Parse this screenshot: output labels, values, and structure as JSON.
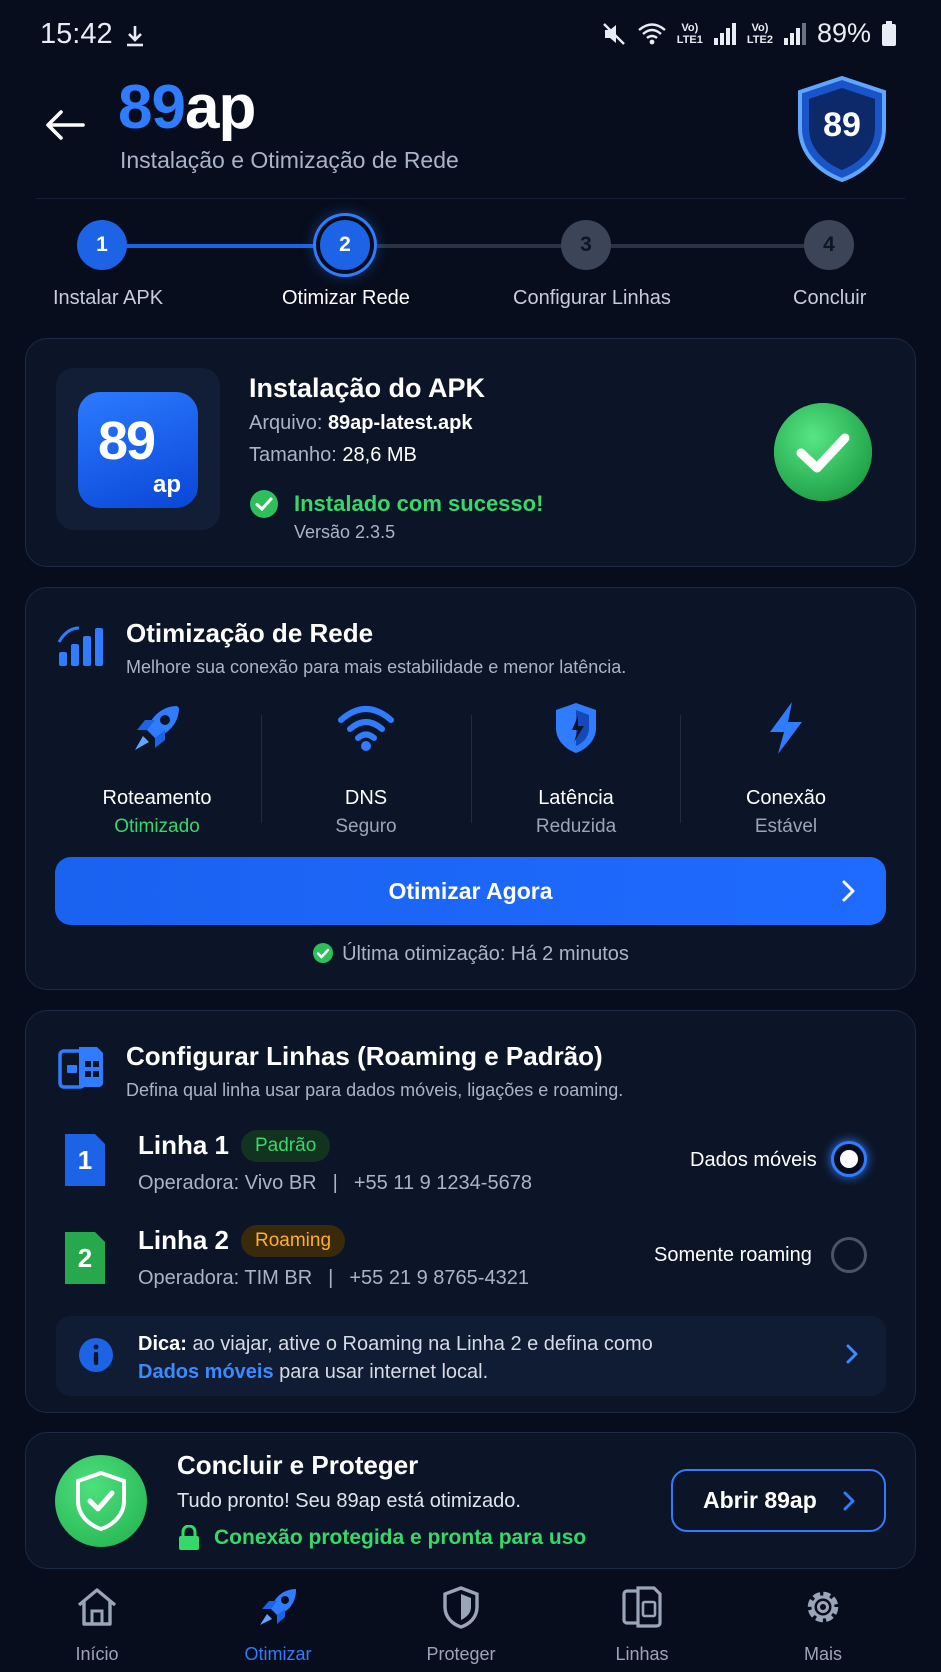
{
  "status_bar": {
    "time": "15:42",
    "lte1": "Vo)\nLTE1",
    "lte2": "Vo)\nLTE2",
    "battery": "89%"
  },
  "header": {
    "brand_part1": "89",
    "brand_part2": "ap",
    "subtitle": "Instalação e Otimização de Rede",
    "badge_number": "89"
  },
  "stepper": {
    "steps": [
      {
        "number": "1",
        "label": "Instalar APK",
        "state": "done"
      },
      {
        "number": "2",
        "label": "Otimizar Rede",
        "state": "active"
      },
      {
        "number": "3",
        "label": "Configurar Linhas",
        "state": "pending"
      },
      {
        "number": "4",
        "label": "Concluir",
        "state": "pending"
      }
    ]
  },
  "apk": {
    "icon_number": "89",
    "icon_suffix": "ap",
    "title": "Instalação do APK",
    "file_label": "Arquivo:",
    "file_value": "89ap-latest.apk",
    "size_label": "Tamanho:",
    "size_value": "28,6 MB",
    "status": "Instalado com sucesso!",
    "version": "Versão 2.3.5"
  },
  "network": {
    "title": "Otimização de Rede",
    "description": "Melhore sua conexão para mais estabilidade e menor latência.",
    "metrics": [
      {
        "name": "Roteamento",
        "value": "Otimizado",
        "icon": "rocket-icon"
      },
      {
        "name": "DNS",
        "value": "Seguro",
        "icon": "wifi-icon"
      },
      {
        "name": "Latência",
        "value": "Reduzida",
        "icon": "shield-icon"
      },
      {
        "name": "Conexão",
        "value": "Estável",
        "icon": "bolt-icon"
      }
    ],
    "button_label": "Otimizar Agora",
    "last_optimization": "Última otimização: Há 2 minutos"
  },
  "lines": {
    "title": "Configurar Linhas (Roaming e Padrão)",
    "description": "Defina qual linha usar para dados móveis, ligações e roaming.",
    "items": [
      {
        "sim": "1",
        "name": "Linha 1",
        "badge": "Padrão",
        "operator": "Operadora: Vivo BR",
        "phone": "+55 11 9 1234-5678",
        "option": "Dados móveis",
        "selected": true
      },
      {
        "sim": "2",
        "name": "Linha 2",
        "badge": "Roaming",
        "operator": "Operadora: TIM BR",
        "phone": "+55 21 9 8765-4321",
        "option": "Somente roaming",
        "selected": false
      }
    ],
    "separator": "|",
    "tip_bold": "Dica:",
    "tip_text1": " ao viajar, ative o Roaming na Linha 2 e defina como",
    "tip_link": "Dados móveis",
    "tip_text2": " para usar internet local."
  },
  "conclude": {
    "title": "Concluir e Proteger",
    "description": "Tudo pronto! Seu 89ap está otimizado.",
    "secure": "Conexão protegida e pronta para uso",
    "button_label": "Abrir 89ap"
  },
  "nav": {
    "items": [
      {
        "label": "Início",
        "icon": "home-icon",
        "active": false
      },
      {
        "label": "Otimizar",
        "icon": "rocket-icon",
        "active": true
      },
      {
        "label": "Proteger",
        "icon": "shield-icon",
        "active": false
      },
      {
        "label": "Linhas",
        "icon": "sim-icon",
        "active": false
      },
      {
        "label": "Mais",
        "icon": "gear-icon",
        "active": false
      }
    ]
  },
  "colors": {
    "background": "#070d1c",
    "accent": "#2f7cff",
    "success": "#35d96a",
    "warning": "#ffb01f"
  }
}
